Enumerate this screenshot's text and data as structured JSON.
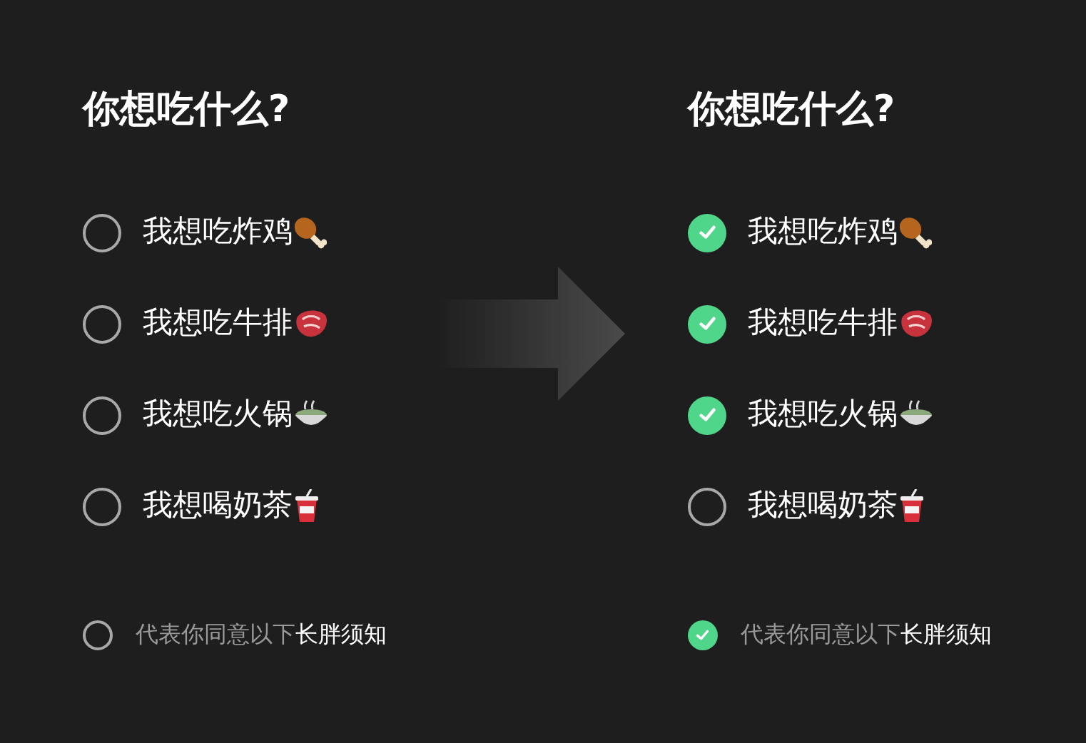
{
  "panels": [
    {
      "title": "你想吃什么?",
      "options": [
        {
          "label": "我想吃炸鸡",
          "kind": "drumstick",
          "checked": false
        },
        {
          "label": "我想吃牛排",
          "kind": "steak",
          "checked": false
        },
        {
          "label": "我想吃火锅",
          "kind": "pot",
          "checked": false
        },
        {
          "label": "我想喝奶茶",
          "kind": "cup",
          "checked": false
        }
      ],
      "agreement": {
        "checked": false,
        "text": "代表你同意以下",
        "link": "长胖须知"
      }
    },
    {
      "title": "你想吃什么?",
      "options": [
        {
          "label": "我想吃炸鸡",
          "kind": "drumstick",
          "checked": true
        },
        {
          "label": "我想吃牛排",
          "kind": "steak",
          "checked": true
        },
        {
          "label": "我想吃火锅",
          "kind": "pot",
          "checked": true
        },
        {
          "label": "我想喝奶茶",
          "kind": "cup",
          "checked": false
        }
      ],
      "agreement": {
        "checked": true,
        "text": "代表你同意以下",
        "link": "长胖须知"
      }
    }
  ]
}
